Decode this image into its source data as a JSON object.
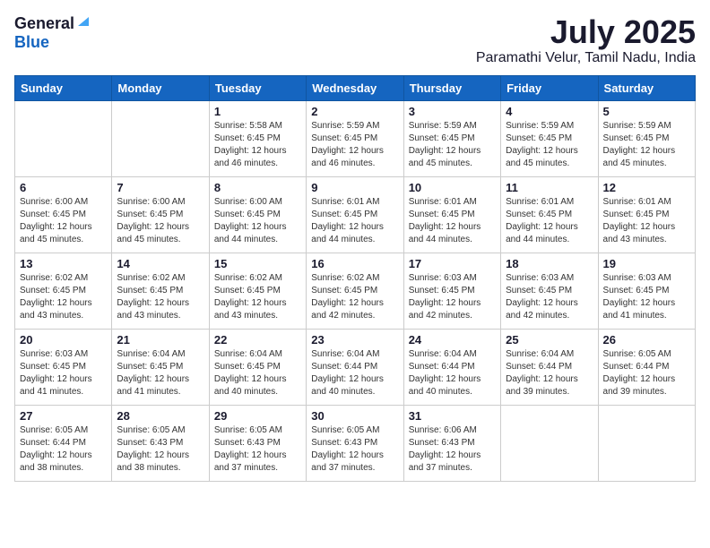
{
  "header": {
    "logo_general": "General",
    "logo_blue": "Blue",
    "month": "July 2025",
    "location": "Paramathi Velur, Tamil Nadu, India"
  },
  "days_of_week": [
    "Sunday",
    "Monday",
    "Tuesday",
    "Wednesday",
    "Thursday",
    "Friday",
    "Saturday"
  ],
  "weeks": [
    [
      {
        "day": "",
        "info": ""
      },
      {
        "day": "",
        "info": ""
      },
      {
        "day": "1",
        "info": "Sunrise: 5:58 AM\nSunset: 6:45 PM\nDaylight: 12 hours and 46 minutes."
      },
      {
        "day": "2",
        "info": "Sunrise: 5:59 AM\nSunset: 6:45 PM\nDaylight: 12 hours and 46 minutes."
      },
      {
        "day": "3",
        "info": "Sunrise: 5:59 AM\nSunset: 6:45 PM\nDaylight: 12 hours and 45 minutes."
      },
      {
        "day": "4",
        "info": "Sunrise: 5:59 AM\nSunset: 6:45 PM\nDaylight: 12 hours and 45 minutes."
      },
      {
        "day": "5",
        "info": "Sunrise: 5:59 AM\nSunset: 6:45 PM\nDaylight: 12 hours and 45 minutes."
      }
    ],
    [
      {
        "day": "6",
        "info": "Sunrise: 6:00 AM\nSunset: 6:45 PM\nDaylight: 12 hours and 45 minutes."
      },
      {
        "day": "7",
        "info": "Sunrise: 6:00 AM\nSunset: 6:45 PM\nDaylight: 12 hours and 45 minutes."
      },
      {
        "day": "8",
        "info": "Sunrise: 6:00 AM\nSunset: 6:45 PM\nDaylight: 12 hours and 44 minutes."
      },
      {
        "day": "9",
        "info": "Sunrise: 6:01 AM\nSunset: 6:45 PM\nDaylight: 12 hours and 44 minutes."
      },
      {
        "day": "10",
        "info": "Sunrise: 6:01 AM\nSunset: 6:45 PM\nDaylight: 12 hours and 44 minutes."
      },
      {
        "day": "11",
        "info": "Sunrise: 6:01 AM\nSunset: 6:45 PM\nDaylight: 12 hours and 44 minutes."
      },
      {
        "day": "12",
        "info": "Sunrise: 6:01 AM\nSunset: 6:45 PM\nDaylight: 12 hours and 43 minutes."
      }
    ],
    [
      {
        "day": "13",
        "info": "Sunrise: 6:02 AM\nSunset: 6:45 PM\nDaylight: 12 hours and 43 minutes."
      },
      {
        "day": "14",
        "info": "Sunrise: 6:02 AM\nSunset: 6:45 PM\nDaylight: 12 hours and 43 minutes."
      },
      {
        "day": "15",
        "info": "Sunrise: 6:02 AM\nSunset: 6:45 PM\nDaylight: 12 hours and 43 minutes."
      },
      {
        "day": "16",
        "info": "Sunrise: 6:02 AM\nSunset: 6:45 PM\nDaylight: 12 hours and 42 minutes."
      },
      {
        "day": "17",
        "info": "Sunrise: 6:03 AM\nSunset: 6:45 PM\nDaylight: 12 hours and 42 minutes."
      },
      {
        "day": "18",
        "info": "Sunrise: 6:03 AM\nSunset: 6:45 PM\nDaylight: 12 hours and 42 minutes."
      },
      {
        "day": "19",
        "info": "Sunrise: 6:03 AM\nSunset: 6:45 PM\nDaylight: 12 hours and 41 minutes."
      }
    ],
    [
      {
        "day": "20",
        "info": "Sunrise: 6:03 AM\nSunset: 6:45 PM\nDaylight: 12 hours and 41 minutes."
      },
      {
        "day": "21",
        "info": "Sunrise: 6:04 AM\nSunset: 6:45 PM\nDaylight: 12 hours and 41 minutes."
      },
      {
        "day": "22",
        "info": "Sunrise: 6:04 AM\nSunset: 6:45 PM\nDaylight: 12 hours and 40 minutes."
      },
      {
        "day": "23",
        "info": "Sunrise: 6:04 AM\nSunset: 6:44 PM\nDaylight: 12 hours and 40 minutes."
      },
      {
        "day": "24",
        "info": "Sunrise: 6:04 AM\nSunset: 6:44 PM\nDaylight: 12 hours and 40 minutes."
      },
      {
        "day": "25",
        "info": "Sunrise: 6:04 AM\nSunset: 6:44 PM\nDaylight: 12 hours and 39 minutes."
      },
      {
        "day": "26",
        "info": "Sunrise: 6:05 AM\nSunset: 6:44 PM\nDaylight: 12 hours and 39 minutes."
      }
    ],
    [
      {
        "day": "27",
        "info": "Sunrise: 6:05 AM\nSunset: 6:44 PM\nDaylight: 12 hours and 38 minutes."
      },
      {
        "day": "28",
        "info": "Sunrise: 6:05 AM\nSunset: 6:43 PM\nDaylight: 12 hours and 38 minutes."
      },
      {
        "day": "29",
        "info": "Sunrise: 6:05 AM\nSunset: 6:43 PM\nDaylight: 12 hours and 37 minutes."
      },
      {
        "day": "30",
        "info": "Sunrise: 6:05 AM\nSunset: 6:43 PM\nDaylight: 12 hours and 37 minutes."
      },
      {
        "day": "31",
        "info": "Sunrise: 6:06 AM\nSunset: 6:43 PM\nDaylight: 12 hours and 37 minutes."
      },
      {
        "day": "",
        "info": ""
      },
      {
        "day": "",
        "info": ""
      }
    ]
  ]
}
